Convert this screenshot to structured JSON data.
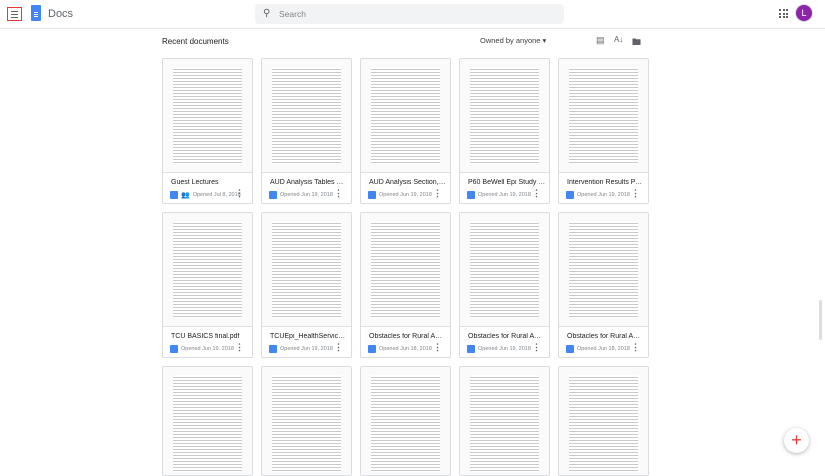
{
  "header": {
    "app_name": "Docs",
    "search_placeholder": "Search",
    "avatar_letter": "L"
  },
  "toolbar": {
    "section_title": "Recent documents",
    "owner_filter": "Owned by anyone ▾"
  },
  "documents": [
    {
      "title": "Guest Lectures",
      "opened": "Opened Jul 8, 2018",
      "shared": true
    },
    {
      "title": "AUD Analysis Tables Draf...",
      "opened": "Opened Jun 19, 2018"
    },
    {
      "title": "AUD Analysis Section, SR...",
      "opened": "Opened Jun 19, 2018"
    },
    {
      "title": "P60 BeWell Epi Study TC...",
      "opened": "Opened Jun 19, 2018"
    },
    {
      "title": "Intervention Results PAR...",
      "opened": "Opened Jun 19, 2018"
    },
    {
      "title": "TCU BASICS final.pdf",
      "opened": "Opened Jun 19, 2018"
    },
    {
      "title": "TCUEpi_HealthServiceUti...",
      "opened": "Opened Jun 19, 2018"
    },
    {
      "title": "Obstacles for Rural Amer...",
      "opened": "Opened Jun 18, 2018"
    },
    {
      "title": "Obstacles for Rural Amer...",
      "opened": "Opened Jun 19, 2018"
    },
    {
      "title": "Obstacles for Rural Amer...",
      "opened": "Opened Jun 18, 2018"
    }
  ],
  "partial_row_count": 5
}
